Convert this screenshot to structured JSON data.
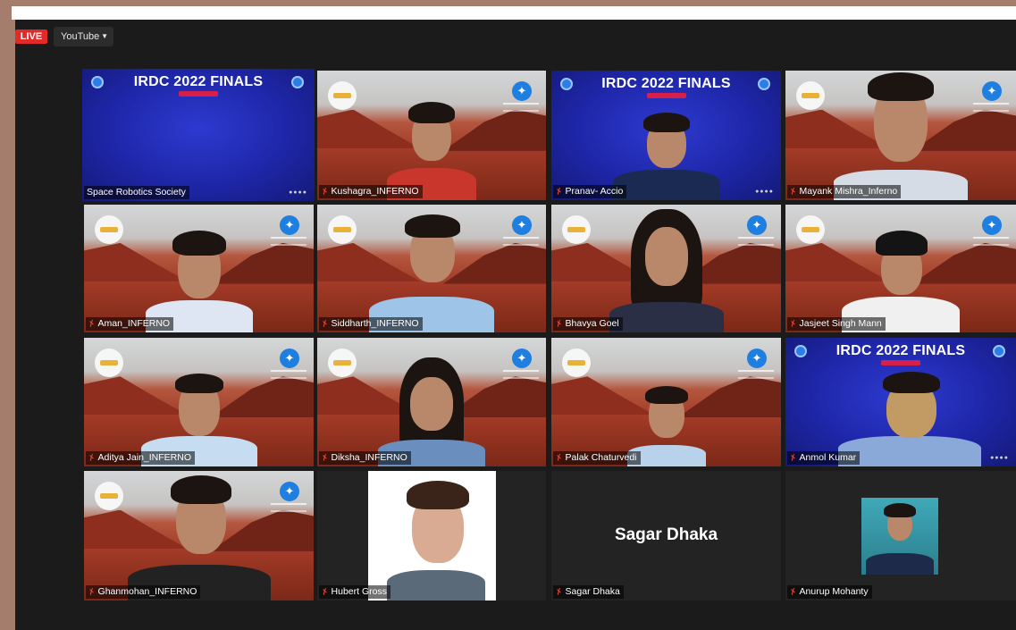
{
  "app": {
    "live_label": "LIVE",
    "stream_target": "YouTube",
    "stream_dropdown_icon": "caret-down-icon"
  },
  "banner": {
    "title": "IRDC 2022 FINALS"
  },
  "participants": [
    {
      "name": "Space Robotics Society",
      "active": true,
      "background": "irdc-banner",
      "muted": false
    },
    {
      "name": "Kushagra_INFERNO",
      "background": "mars",
      "muted": true,
      "shirt": "#c9372c"
    },
    {
      "name": "Pranav- Accio",
      "background": "irdc-banner",
      "muted": true,
      "shirt": "#1a2a52"
    },
    {
      "name": "Mayank Mishra_Inferno",
      "background": "mars",
      "muted": true,
      "shirt": "#d6dce6"
    },
    {
      "name": "Aman_INFERNO",
      "background": "mars",
      "muted": true,
      "shirt": "#dde6f2"
    },
    {
      "name": "Siddharth_INFERNO",
      "background": "mars",
      "muted": true,
      "shirt": "#9ec4e8"
    },
    {
      "name": "Bhavya Goel",
      "background": "mars",
      "muted": true,
      "shirt": "#2a2f45"
    },
    {
      "name": "Jasjeet Singh Mann",
      "background": "mars",
      "muted": true,
      "shirt": "#f0f0f0"
    },
    {
      "name": "Aditya Jain_INFERNO",
      "background": "mars",
      "muted": true,
      "shirt": "#c6dcf0"
    },
    {
      "name": "Diksha_INFERNO",
      "background": "mars",
      "muted": true,
      "shirt": "#6a8fbf"
    },
    {
      "name": "Palak Chaturvedi",
      "background": "mars",
      "muted": true,
      "shirt": "#b9d2ec"
    },
    {
      "name": "Anmol Kumar",
      "background": "irdc-banner",
      "muted": true,
      "shirt": "#8aa8d8"
    },
    {
      "name": "Ghanmohan_INFERNO",
      "background": "mars",
      "muted": true,
      "shirt": "#222222"
    },
    {
      "name": "Hubert Gross",
      "background": "photo-white",
      "muted": true,
      "shirt": "#5a6a78"
    },
    {
      "name": "Sagar Dhaka",
      "background": "camera-off",
      "muted": true,
      "display_text": "Sagar Dhaka"
    },
    {
      "name": "Anurup Mohanty",
      "background": "photo-teal",
      "muted": true,
      "shirt": "#1e2a4a"
    }
  ],
  "colors": {
    "live": "#e22a2a",
    "active_speaker_border": "#c7de59",
    "muted_mic": "#e14a3a",
    "banner_blue": "#1e26a8"
  }
}
